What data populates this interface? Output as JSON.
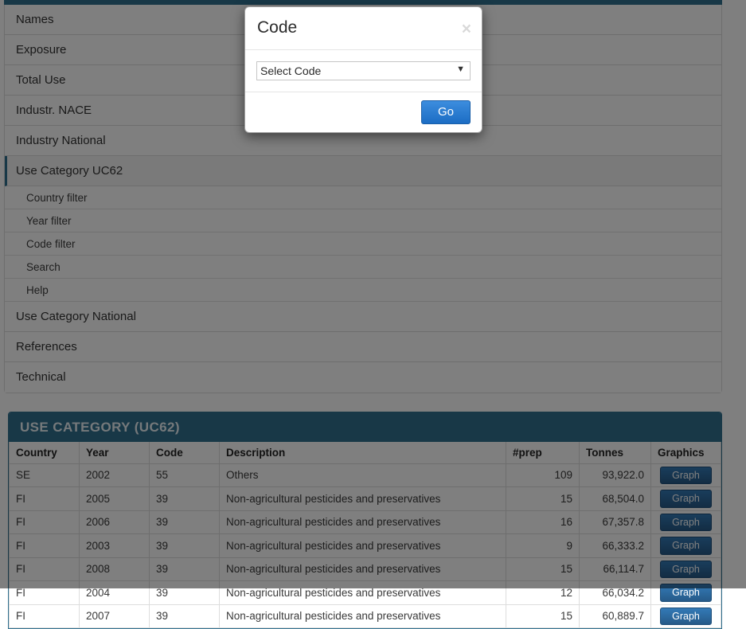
{
  "theme": {
    "accent_teal": "#31708f",
    "button_blue": "#2a6496",
    "go_blue": "#2176c7"
  },
  "nav": {
    "items": [
      {
        "label": "Names",
        "active": false
      },
      {
        "label": "Exposure",
        "active": false
      },
      {
        "label": "Total Use",
        "active": false
      },
      {
        "label": "Industr. NACE",
        "active": false
      },
      {
        "label": "Industry National",
        "active": false
      },
      {
        "label": "Use Category UC62",
        "active": true
      }
    ],
    "subitems": [
      {
        "label": "Country filter"
      },
      {
        "label": "Year filter"
      },
      {
        "label": "Code filter"
      },
      {
        "label": "Search"
      },
      {
        "label": "Help"
      }
    ],
    "items_after": [
      {
        "label": "Use Category National",
        "active": false
      },
      {
        "label": "References",
        "active": false
      },
      {
        "label": "Technical",
        "active": false
      }
    ]
  },
  "card": {
    "title": "USE CATEGORY (UC62)",
    "columns": [
      "Country",
      "Year",
      "Code",
      "Description",
      "#prep",
      "Tonnes",
      "Graphics"
    ],
    "graph_button_label": "Graph",
    "rows": [
      {
        "country": "SE",
        "year": "2002",
        "code": "55",
        "description": "Others",
        "prep": "109",
        "tonnes": "93,922.0"
      },
      {
        "country": "FI",
        "year": "2005",
        "code": "39",
        "description": "Non-agricultural pesticides and preservatives",
        "prep": "15",
        "tonnes": "68,504.0"
      },
      {
        "country": "FI",
        "year": "2006",
        "code": "39",
        "description": "Non-agricultural pesticides and preservatives",
        "prep": "16",
        "tonnes": "67,357.8"
      },
      {
        "country": "FI",
        "year": "2003",
        "code": "39",
        "description": "Non-agricultural pesticides and preservatives",
        "prep": "9",
        "tonnes": "66,333.2"
      },
      {
        "country": "FI",
        "year": "2008",
        "code": "39",
        "description": "Non-agricultural pesticides and preservatives",
        "prep": "15",
        "tonnes": "66,114.7"
      },
      {
        "country": "FI",
        "year": "2004",
        "code": "39",
        "description": "Non-agricultural pesticides and preservatives",
        "prep": "12",
        "tonnes": "66,034.2"
      },
      {
        "country": "FI",
        "year": "2007",
        "code": "39",
        "description": "Non-agricultural pesticides and preservatives",
        "prep": "15",
        "tonnes": "60,889.7"
      }
    ]
  },
  "modal": {
    "title": "Code",
    "close_label": "×",
    "select": {
      "selected": "Select Code",
      "options": [
        "Select Code"
      ],
      "arrow": "▼"
    },
    "submit_label": "Go"
  }
}
